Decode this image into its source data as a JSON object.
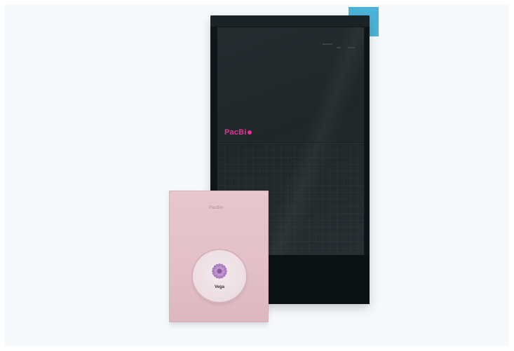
{
  "tower": {
    "logo_text": "PacBi",
    "screen_tiny_title": "",
    "screen_tiny_sub": ""
  },
  "kit": {
    "logo_text": "PacBio",
    "label": "Vega"
  },
  "colors": {
    "brand_magenta": "#e0329a",
    "accent_blue": "#4ab4d8",
    "kit_pink": "#e7c6cd",
    "instrument_dark": "#0f1619"
  },
  "icons": [
    "flower-graphic",
    "brand-dot"
  ]
}
